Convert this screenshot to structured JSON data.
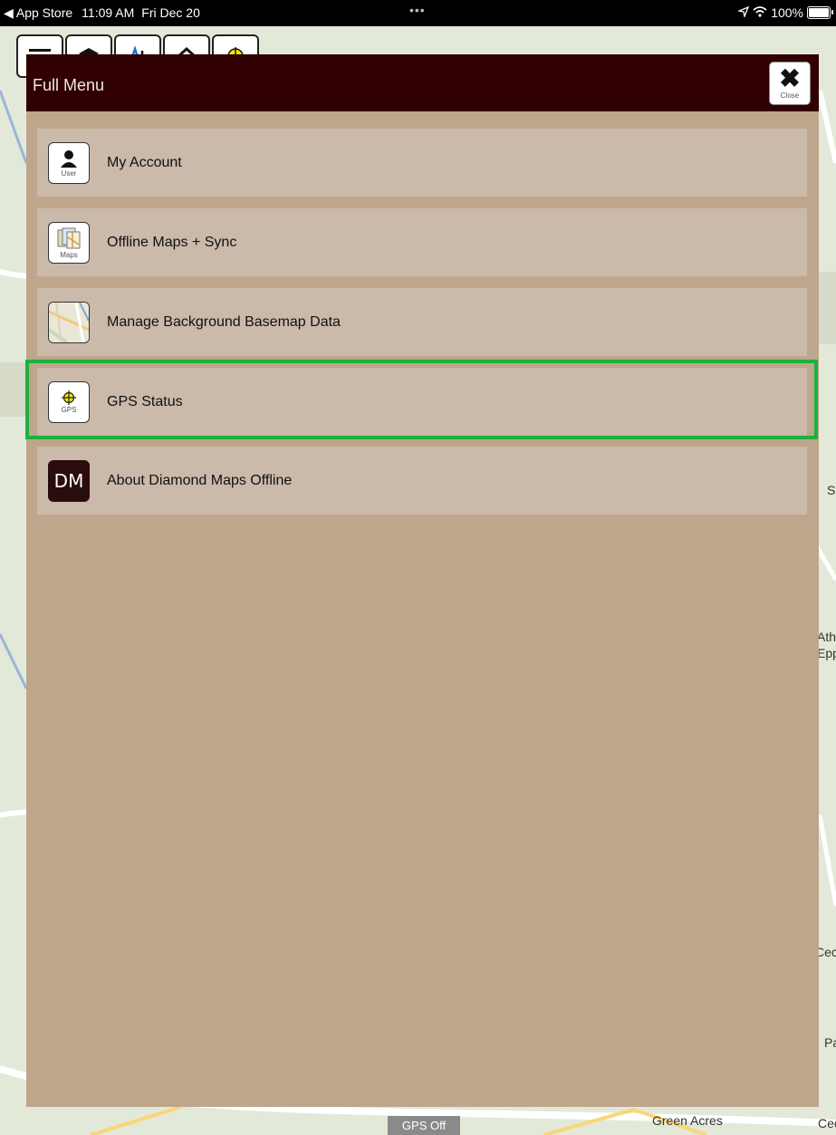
{
  "status_bar": {
    "back_app": "◀ App Store",
    "time": "11:09 AM",
    "date": "Fri Dec 20",
    "dots": "•••",
    "battery": "100%"
  },
  "toolbar": {
    "buttons": [
      "menu-icon",
      "layers-icon",
      "measure-icon",
      "home-icon",
      "gps-target-icon"
    ]
  },
  "panel": {
    "title": "Full Menu",
    "close_label": "Close",
    "items": [
      {
        "label": "My Account",
        "icon": "user-icon",
        "icon_caption": "User"
      },
      {
        "label": "Offline Maps + Sync",
        "icon": "maps-icon",
        "icon_caption": "Maps"
      },
      {
        "label": "Manage Background Basemap Data",
        "icon": "basemap-icon",
        "icon_caption": ""
      },
      {
        "label": "GPS Status",
        "icon": "gps-icon",
        "icon_caption": "GPS"
      },
      {
        "label": "About Diamond Maps Offline",
        "icon": "dm-logo-icon",
        "icon_caption": "DM"
      }
    ],
    "highlighted_item": "GPS Status"
  },
  "map": {
    "labels": [
      "S",
      "Ath",
      "Epp",
      "Cec",
      "Pa",
      "Green Acres",
      "Cec"
    ],
    "gps_status": "GPS Off"
  },
  "colors": {
    "panel_header": "#300002",
    "panel_body": "#bea68c",
    "menu_item": "#cbb9aa",
    "highlight": "#1eaf3e"
  }
}
